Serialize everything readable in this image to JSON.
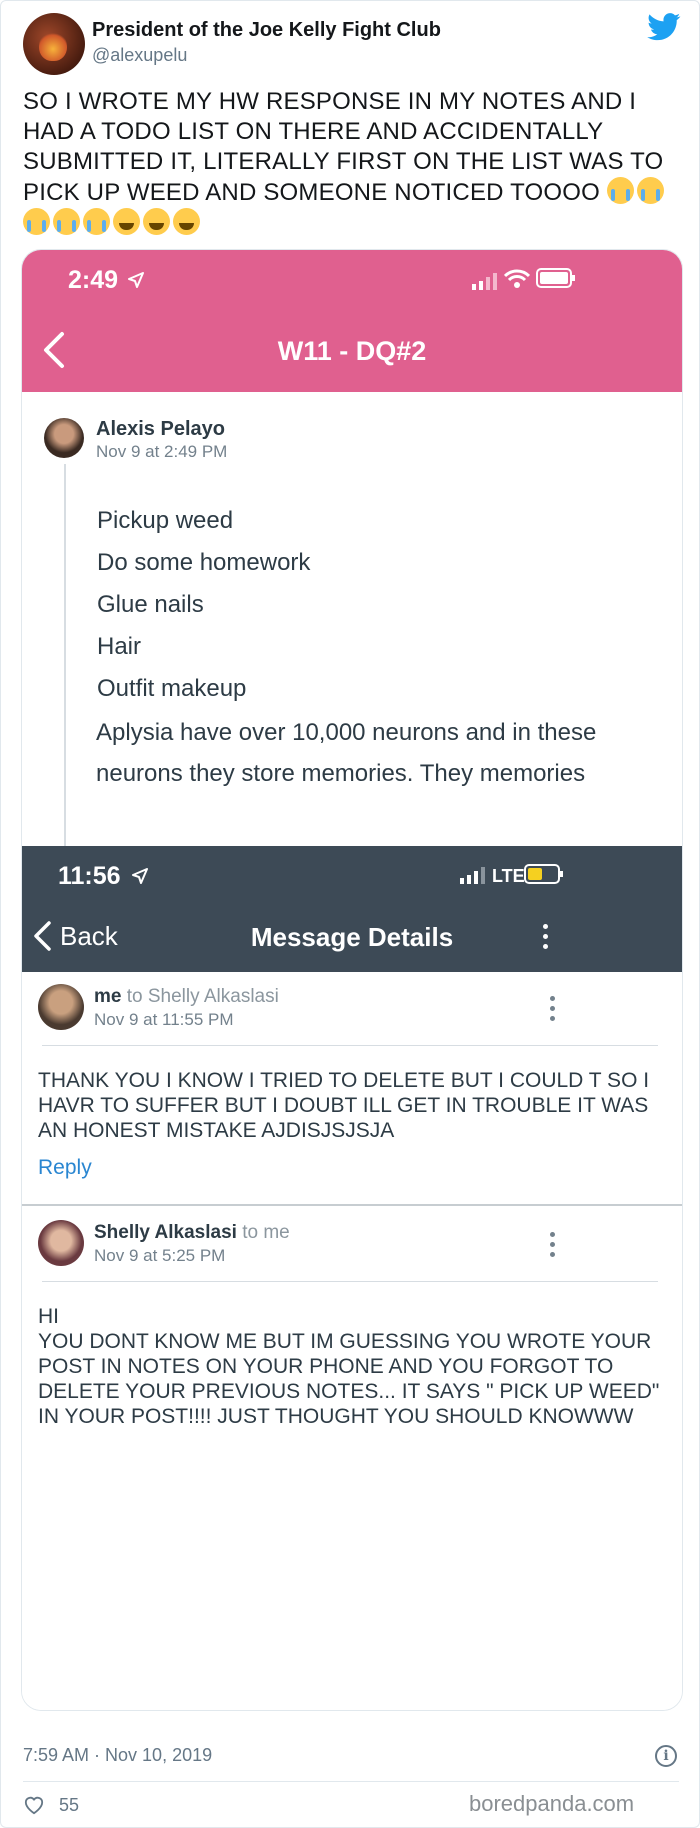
{
  "tweet": {
    "display_name": "President of the Joe Kelly Fight Club",
    "handle": "@alexupelu",
    "text": "SO I WROTE MY HW RESPONSE IN MY NOTES AND I HAD A TODO LIST ON THERE AND ACCIDENTALLY SUBMITTED IT,  LITERALLY FIRST ON THE LIST WAS TO PICK UP WEED AND SOMEONE NOTICED TOOOO",
    "emojis": [
      "loudly-crying-face",
      "loudly-crying-face",
      "loudly-crying-face",
      "loudly-crying-face",
      "loudly-crying-face",
      "face-with-tears-of-joy",
      "face-with-tears-of-joy",
      "face-with-tears-of-joy"
    ],
    "timestamp": "7:59 AM · Nov 10, 2019",
    "likes": "55",
    "watermark": "boredpanda.com",
    "brand_color": "#1da1f2"
  },
  "screenshot1": {
    "status_time": "2:49",
    "nav_title": "W11 - DQ#2",
    "header_color": "#e0608f",
    "post": {
      "author": "Alexis Pelayo",
      "date": "Nov 9 at 2:49 PM",
      "todo": [
        "Pickup weed",
        "Do some homework",
        "Glue nails",
        "Hair",
        "Outfit makeup"
      ],
      "paragraph": "Aplysia have over 10,000 neurons and in these neurons they store memories. They memories"
    }
  },
  "screenshot2": {
    "status_time": "11:56",
    "network": "LTE",
    "back_label": "Back",
    "nav_title": "Message Details",
    "header_color": "#3d4a56",
    "messages": [
      {
        "from": "me",
        "to_text": "to Shelly Alkaslasi",
        "date": "Nov 9 at 11:55 PM",
        "body": "THANK YOU I KNOW I TRIED TO DELETE BUT I COULD T SO I HAVR TO SUFFER BUT I DOUBT ILL GET IN TROUBLE IT WAS AN HONEST MISTAKE AJDISJSJSJA",
        "reply_label": "Reply"
      },
      {
        "from": "Shelly Alkaslasi",
        "to_text": "to me",
        "date": "Nov 9 at 5:25 PM",
        "body": "HI\nYOU DONT KNOW ME BUT IM GUESSING YOU WROTE YOUR POST IN NOTES ON YOUR PHONE AND YOU FORGOT TO DELETE YOUR PREVIOUS NOTES... IT SAYS \" PICK UP WEED\" IN YOUR POST!!!! JUST THOUGHT YOU SHOULD KNOWWW"
      }
    ]
  }
}
